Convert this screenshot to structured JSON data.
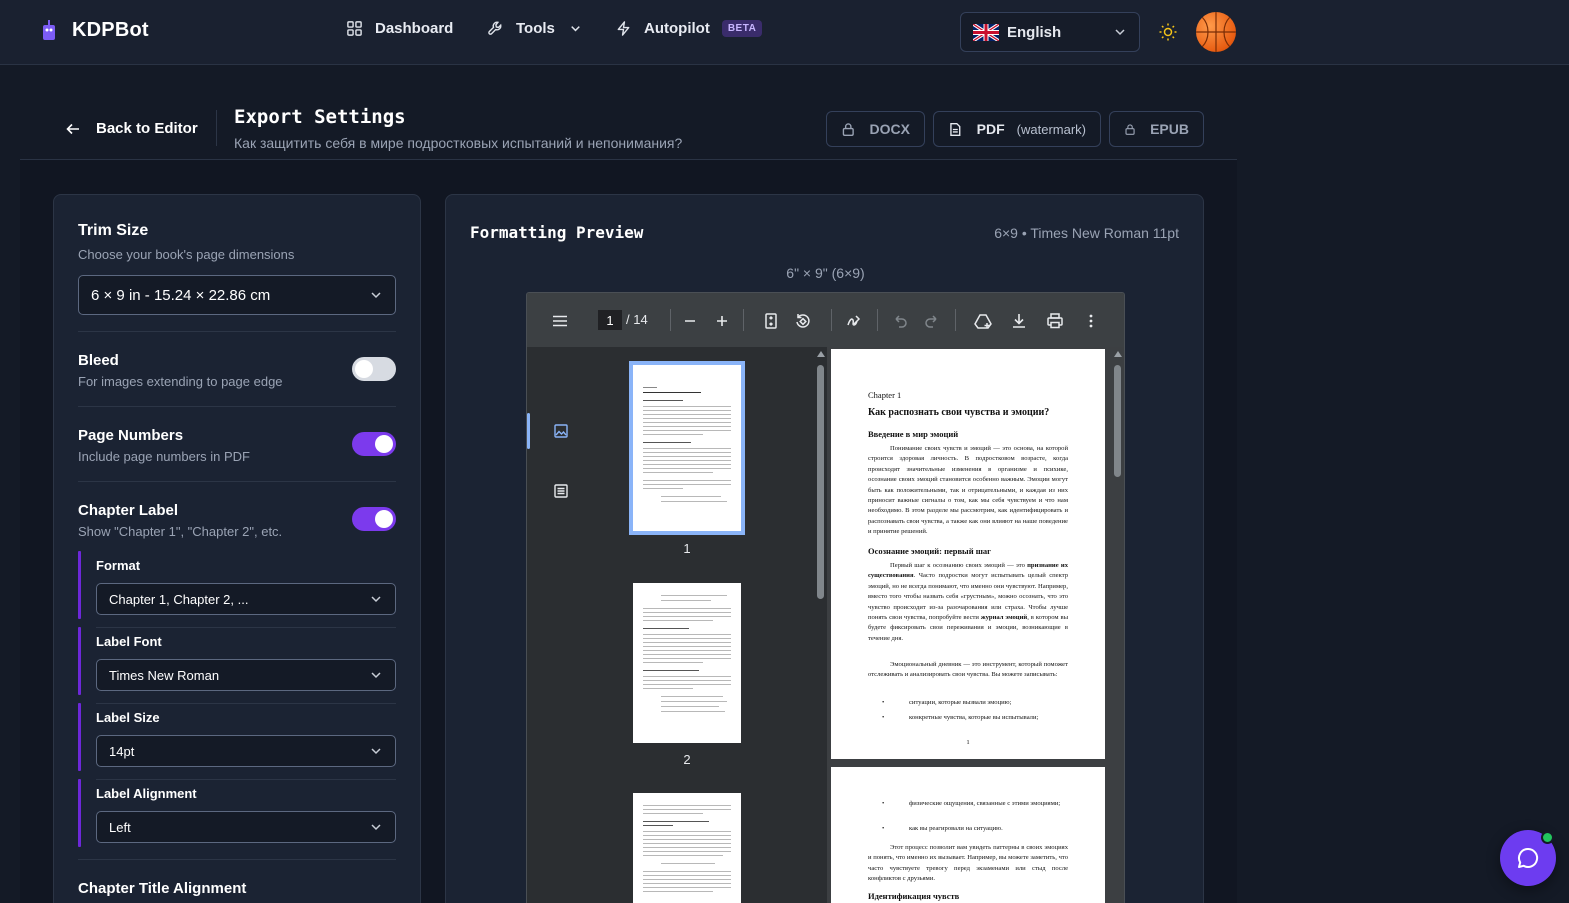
{
  "app": {
    "name": "KDPBot"
  },
  "nav": {
    "dashboard": "Dashboard",
    "tools": "Tools",
    "autopilot": "Autopilot",
    "beta": "BETA"
  },
  "language": {
    "selected": "English"
  },
  "header": {
    "back": "Back to Editor",
    "title": "Export Settings",
    "subtitle": "Как защитить себя в мире подростковых испытаний и непонимания?",
    "formats": {
      "docx": "DOCX",
      "pdf": "PDF",
      "pdf_note": "(watermark)",
      "epub": "EPUB"
    }
  },
  "settings": {
    "trim": {
      "title": "Trim Size",
      "desc": "Choose your book's page dimensions",
      "value": "6 × 9 in - 15.24 × 22.86 cm"
    },
    "bleed": {
      "title": "Bleed",
      "desc": "For images extending to page edge",
      "enabled": false
    },
    "page_numbers": {
      "title": "Page Numbers",
      "desc": "Include page numbers in PDF",
      "enabled": true
    },
    "chapter_label": {
      "title": "Chapter Label",
      "desc": "Show \"Chapter 1\", \"Chapter 2\", etc.",
      "enabled": true,
      "format_label": "Format",
      "format_value": "Chapter 1, Chapter 2, ...",
      "font_label": "Label Font",
      "font_value": "Times New Roman",
      "size_label": "Label Size",
      "size_value": "14pt",
      "align_label": "Label Alignment",
      "align_value": "Left"
    },
    "chapter_title_alignment": {
      "title": "Chapter Title Alignment"
    }
  },
  "preview": {
    "title": "Formatting Preview",
    "meta": "6×9 • Times New Roman 11pt",
    "size": "6\" × 9\" (6×9)",
    "viewer": {
      "current_page": "1",
      "total": "/ 14",
      "thumb_labels": [
        "1",
        "2"
      ]
    },
    "page1": {
      "chapter": "Chapter 1",
      "heading": "Как распознать свои чувства и эмоции?",
      "section1": "Введение в мир эмоций",
      "para1": "Понимание своих чувств и эмоций — это основа, на которой строится здоровая личность. В подростковом возрасте, когда происходят значительные изменения в организме и психике, осознание своих эмоций становится особенно важным. Эмоции могут быть как положительными, так и отрицательными, и каждая из них приносит важные сигналы о том, как мы себя чувствуем и что нам необходимо. В этом разделе мы рассмотрим, как идентифицировать и распознавать свои чувства, а также как они влияют на наше поведение и принятие решений.",
      "section2": "Осознание эмоций: первый шаг",
      "para2a": "Первый шаг к осознанию своих эмоций — это",
      "para2b": "признание их существования",
      "para2c": ". Часто подростки могут испытывать целый спектр эмоций, но не всегда понимают, что именно они чувствуют. Например, вместо того чтобы назвать себя «грустным», можно осознать, что это чувство происходит из-за разочарования или страха. Чтобы лучше понять свои чувства, попробуйте вести",
      "para2d": "журнал эмоций",
      "para2e": ", в котором вы будете фиксировать свои переживания и эмоции, возникающие в течение дня.",
      "para3": "Эмоциональный дневник — это инструмент, который поможет отслеживать и анализировать свои чувства. Вы можете записывать:",
      "bullets": [
        "ситуации, которые вызвали эмоцию;",
        "конкретные чувства, которые вы испытывали;"
      ],
      "page_number": "1"
    },
    "page2": {
      "bullets": [
        "физические ощущения, связанные с этими эмоциями;",
        "как вы реагировали на ситуацию."
      ],
      "para1": "Этот процесс позволит вам увидеть паттерны в своих эмоциях и понять, что именно их вызывает. Например, вы можете заметить, что часто чувствуете тревогу перед экзаменами или стыд после конфликтов с друзьями.",
      "section": "Идентификация чувств"
    }
  },
  "colors": {
    "accent": "#7c3aed",
    "background": "#141a26",
    "card": "#1b2333"
  }
}
